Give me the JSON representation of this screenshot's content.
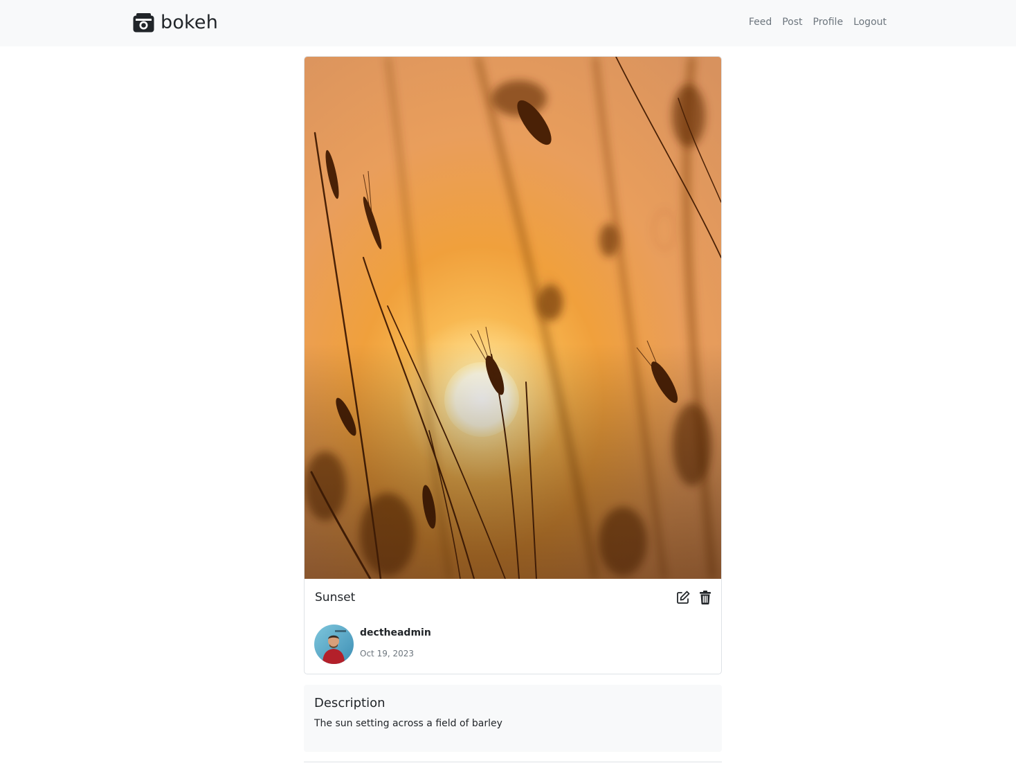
{
  "navbar": {
    "brand_name": "bokeh",
    "brand_icon": "camera-icon",
    "links": [
      "Feed",
      "Post",
      "Profile",
      "Logout"
    ]
  },
  "post": {
    "photo": "sunset-barley-photo",
    "title": "Sunset",
    "actions": {
      "edit_icon": "edit-icon",
      "delete_icon": "trash-icon"
    },
    "author": {
      "username": "dectheadmin",
      "date": "Oct 19, 2023",
      "avatar": "user-avatar"
    }
  },
  "description": {
    "heading": "Description",
    "text": "The sun setting across a field of barley"
  },
  "colors": {
    "navbar_bg": "#f8f9fa",
    "nav_link": "#6c757d",
    "text": "#212529",
    "muted": "#6c757d",
    "border": "#dee2e6",
    "sunset_orange": "#e8902e"
  }
}
